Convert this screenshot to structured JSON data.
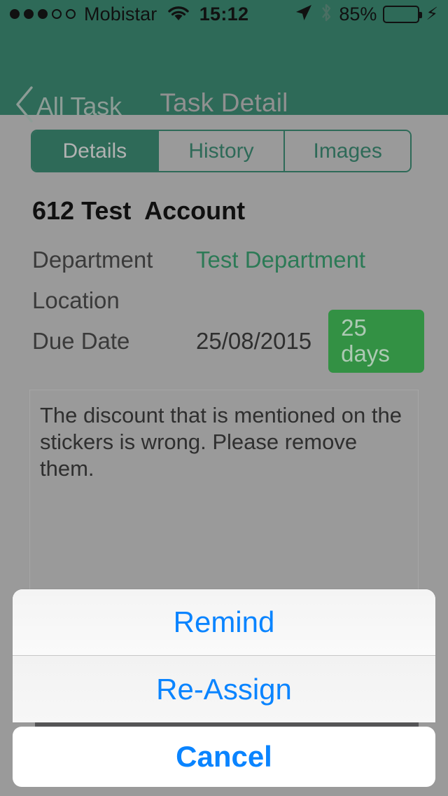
{
  "status_bar": {
    "signal_dots_total": 5,
    "signal_dots_filled": 3,
    "carrier": "Mobistar",
    "wifi_icon": "wifi-icon",
    "time": "15:12",
    "location_icon": "location-arrow-icon",
    "bluetooth_icon": "bluetooth-icon",
    "battery_percent": "85%",
    "battery_level": 85,
    "charging_icon": "lightning-bolt-icon"
  },
  "nav": {
    "back_icon": "chevron-left-icon",
    "back_label": "All Task",
    "title": "Task Detail"
  },
  "segmented_control": {
    "selected": "Details",
    "segments": [
      {
        "label": "Details",
        "selected": true
      },
      {
        "label": "History",
        "selected": false
      },
      {
        "label": "Images",
        "selected": false
      }
    ]
  },
  "task": {
    "title": "612 Test  Account",
    "fields": [
      {
        "label": "Department",
        "value": "Test Department"
      },
      {
        "label": "Location",
        "value": ""
      },
      {
        "label": "Due Date",
        "value": "25/08/2015",
        "badge": "25 days"
      }
    ],
    "description": "The discount that is mentioned on the stickers is wrong. Please remove them."
  },
  "action_sheet": {
    "buttons": [
      {
        "label": "Remind"
      },
      {
        "label": "Re-Assign"
      }
    ],
    "cancel_label": "Cancel"
  },
  "colors": {
    "nav_background": "#2e6a58",
    "page_background": "#9a9a9a",
    "accent_teal": "#2c7a56",
    "badge_green": "#339144",
    "action_blue": "#0a84ff",
    "battery_green": "#3ba23f"
  }
}
